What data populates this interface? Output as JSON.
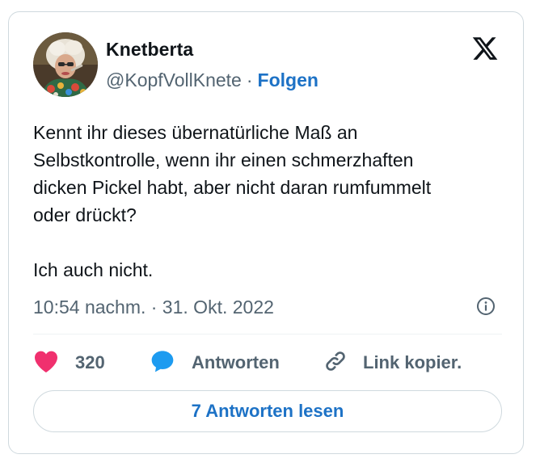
{
  "author": {
    "name": "Knetberta",
    "handle": "@KopfVollKnete",
    "separator": "·",
    "follow_label": "Folgen"
  },
  "tweet": {
    "text": "Kennt ihr dieses übernatürliche Maß an\nSelbstkontrolle, wenn ihr einen schmerzhaften\ndicken Pickel habt, aber nicht daran rumfummelt\noder drückt?\n\nIch auch nicht.",
    "timestamp": "10:54 nachm. · 31. Okt. 2022"
  },
  "actions": {
    "like_count": "320",
    "reply_label": "Antworten",
    "copy_label": "Link kopier."
  },
  "read_replies_label": "7 Antworten lesen",
  "icons": {
    "brand": "x-logo-icon",
    "info": "info-icon",
    "like": "heart-icon",
    "reply": "speech-bubble-icon",
    "copy": "link-icon"
  },
  "colors": {
    "accent": "#1d72c6",
    "like": "#f0306e",
    "secondary_text": "#536471",
    "border": "#cfd9de"
  }
}
